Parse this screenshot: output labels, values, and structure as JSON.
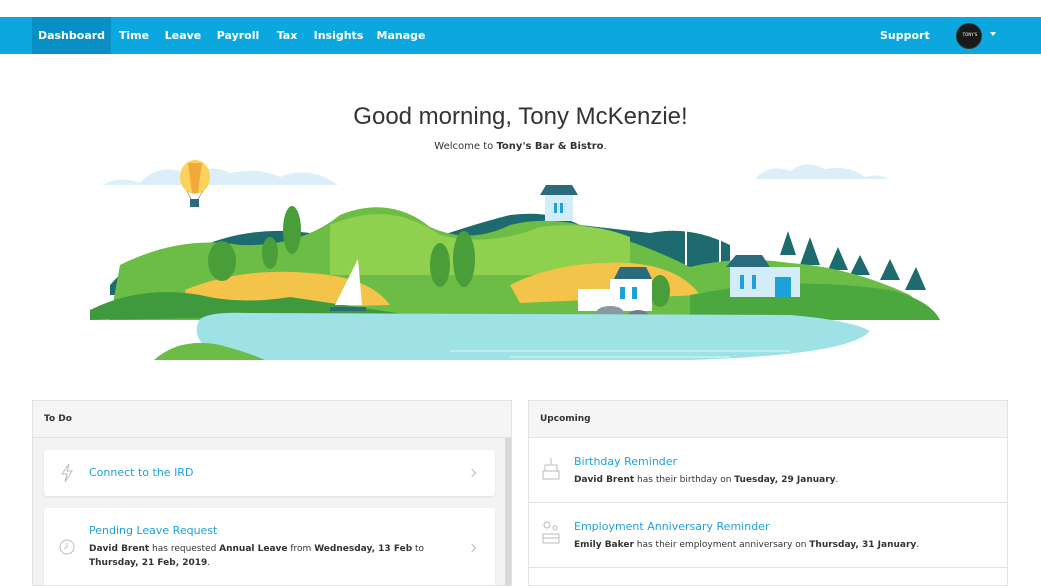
{
  "nav": {
    "items": [
      {
        "label": "Dashboard",
        "active": true
      },
      {
        "label": "Time"
      },
      {
        "label": "Leave"
      },
      {
        "label": "Payroll"
      },
      {
        "label": "Tax"
      },
      {
        "label": "Insights"
      },
      {
        "label": "Manage"
      }
    ],
    "support": "Support",
    "avatar_text": "TONY'S"
  },
  "greeting": {
    "title": "Good morning, Tony McKenzie!",
    "welcome_prefix": "Welcome to ",
    "business": "Tony's Bar & Bistro",
    "welcome_suffix": "."
  },
  "todo": {
    "heading": "To Do",
    "items": [
      {
        "title": "Connect to the IRD",
        "icon": "lightning-icon"
      },
      {
        "title": "Pending Leave Request",
        "icon": "clock-icon",
        "name": "David Brent",
        "mid1": " has requested ",
        "leave_type": "Annual Leave",
        "mid2": " from ",
        "from": "Wednesday, 13 Feb",
        "mid3": " to ",
        "to": "Thursday, 21 Feb, 2019",
        "end": "."
      }
    ]
  },
  "upcoming": {
    "heading": "Upcoming",
    "items": [
      {
        "title": "Birthday Reminder",
        "icon": "cake-icon",
        "name": "David Brent",
        "mid": " has their birthday on ",
        "date": "Tuesday, 29 January",
        "end": "."
      },
      {
        "title": "Employment Anniversary Reminder",
        "icon": "anniversary-icon",
        "name": "Emily Baker",
        "mid": " has their employment anniversary on ",
        "date": "Thursday, 31 January",
        "end": "."
      }
    ]
  },
  "colors": {
    "nav_bg": "#0da7e0",
    "nav_active": "#0a8fc4",
    "link": "#1da1d8"
  }
}
